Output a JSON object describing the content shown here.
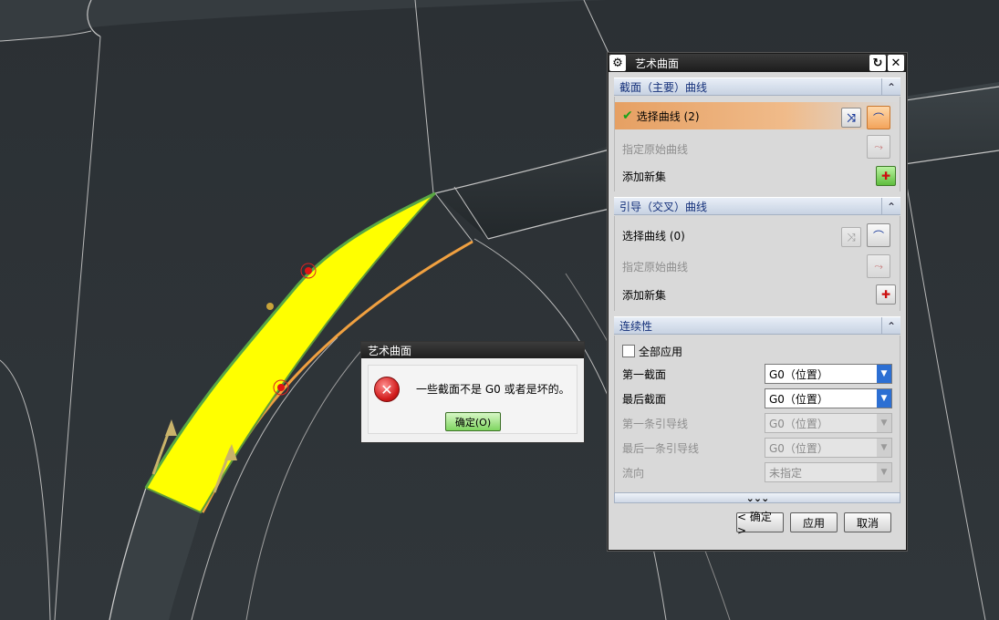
{
  "dialog": {
    "title": "艺术曲面",
    "sections": {
      "section_curves": {
        "header": "截面（主要）曲线",
        "select_label": "选择曲线 (2)",
        "specify_label": "指定原始曲线",
        "add_label": "添加新集"
      },
      "guide_curves": {
        "header": "引导（交叉）曲线",
        "select_label": "选择曲线 (0)",
        "specify_label": "指定原始曲线",
        "add_label": "添加新集"
      },
      "continuity": {
        "header": "连续性",
        "apply_all_label": "全部应用",
        "first_section_label": "第一截面",
        "first_section_value": "G0（位置）",
        "last_section_label": "最后截面",
        "last_section_value": "G0（位置）",
        "first_guide_label": "第一条引导线",
        "first_guide_value": "G0（位置）",
        "last_guide_label": "最后一条引导线",
        "last_guide_value": "G0（位置）",
        "flow_label": "流向",
        "flow_value": "未指定"
      }
    },
    "more_glyph": "⌄⌄⌄",
    "ok_label": "< 确定 >",
    "apply_label": "应用",
    "cancel_label": "取消"
  },
  "error_popup": {
    "title": "艺术曲面",
    "message": "一些截面不是 G0 或者是坏的。",
    "ok_label": "确定(O)"
  },
  "colors": {
    "viewport_bg": "#2a3035",
    "surface_fill": "#ffff00",
    "selected_row": "#f0b07a",
    "section_header": "#d0dae8"
  }
}
